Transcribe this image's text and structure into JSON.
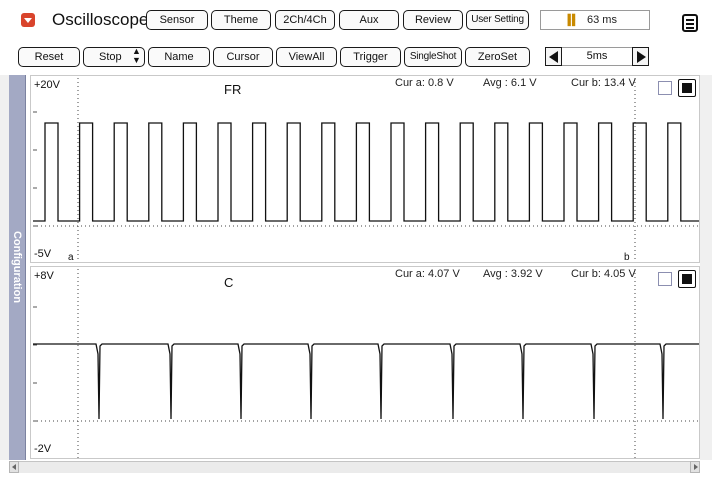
{
  "app": {
    "title": "Oscilloscope",
    "logo_icon": "dropdown-arrow-icon"
  },
  "toolbar_top": {
    "buttons": [
      "Sensor",
      "Theme",
      "2Ch/4Ch",
      "Aux",
      "Review",
      "User Setting"
    ],
    "elapsed": "63 ms",
    "menu_icon": "menu-icon"
  },
  "toolbar_bottom": {
    "buttons": [
      "Reset",
      "Stop",
      "Name",
      "Cursor",
      "ViewAll",
      "Trigger",
      "SingleShot",
      "ZeroSet"
    ],
    "timebase": "5ms"
  },
  "sidebar": {
    "label": "Configuration"
  },
  "channels": [
    {
      "name": "FR",
      "scale_top": "+20V",
      "scale_bottom": "-5V",
      "cursor_a": "Cur a: 0.8 V",
      "avg": "Avg   : 6.1 V",
      "cursor_b": "Cur b: 13.4 V",
      "cursor_a_tag": "a",
      "cursor_b_tag": "b"
    },
    {
      "name": "C",
      "scale_top": "+8V",
      "scale_bottom": "-2V",
      "cursor_a": "Cur a: 4.07 V",
      "avg": "Avg   : 3.92 V",
      "cursor_b": "Cur b: 4.05 V"
    }
  ],
  "colors": {
    "accent": "#d9442c",
    "sidebar": "#a3a9c4",
    "trace": "#111111",
    "grid": "#444444"
  }
}
